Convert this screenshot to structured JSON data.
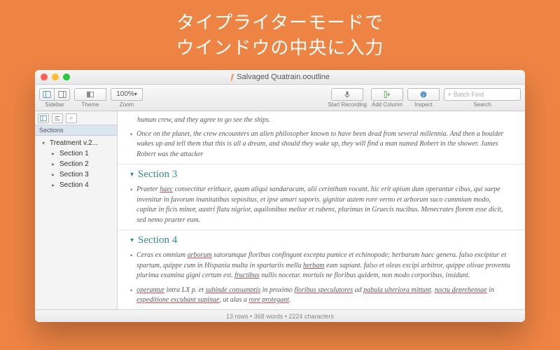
{
  "promo": {
    "line1": "タイプライターモードで",
    "line2": "ウインドウの中央に入力"
  },
  "window": {
    "title": "Salvaged Quatrain.ooutline",
    "toolbar": {
      "sidebar_label": "Sidebar",
      "theme_label": "Theme",
      "zoom_label": "Zoom",
      "zoom_value": "100%",
      "start_recording": "Start Recording",
      "add_column": "Add Column",
      "inspect": "Inspect",
      "search_label": "Search",
      "search_placeholder": "Batch Find"
    }
  },
  "sidebar": {
    "header": "Sections",
    "root": "Treatment v.2...",
    "items": [
      "Section 1",
      "Section 2",
      "Section 3",
      "Section 4"
    ]
  },
  "content": {
    "frag1": "human crew, and they agree to go see the ships.",
    "frag2": "Once on the planet, the crew encounters an alien philosopher known to have been dead from several millennia. And then a boulder wakes up and tell them that this is all a dream, and should they wake up, they will find a man named Robert in the shower. James Robert was the attacker",
    "sec3": "Section 3",
    "sec3_body": "Praeter haec consectitur erithace, quam aliqui sandaracam, alii cerinthum vocant. hic erit apium dum operantur cibus, qui saepe invenitur in favorum inanitatibus sepositus, et ipse amari saporis. gignitur autem rore verno et arborum suco cummium modo, capitur in ficis minor, austri flatu nigrior, aquilonibus melior et rubens, plurimus in Graecis nucibus. Menecrates florem esse dicit, sed nemo praeter eum.",
    "sec4": "Section 4",
    "sec4_b1": "Ceras ex omnium arborum satorumque floribus confingunt excepta pumice et echinopode; herbarum haec genera. falso excipitur et spartum, quippe cum in Hispania multa in spartariis mella herbam eam sapiant. falso et oleas excipi arbitror, quippe olivae proventu plurima examina gigni certum est. fructibus nullis nocetur. mortuis ne floribus quidem, non modo corporibus, insidunt.",
    "sec4_b2": "operantur intra LX p. et subinde consumptis in proximo floribus speculatores ad pabula ulteriora mittunt. noctu deprehensae in expeditione excubant supinae, ut alas a rore protegant."
  },
  "statusbar": "13 rows • 368 words • 2224 characters"
}
